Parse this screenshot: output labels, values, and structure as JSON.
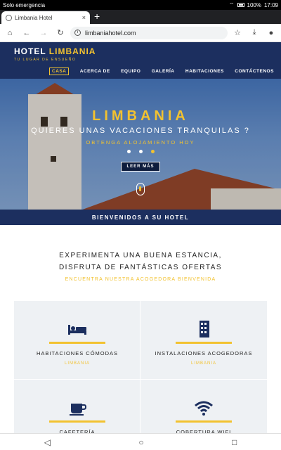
{
  "status_bar": {
    "left_text": "Solo emergencia",
    "battery": "100%",
    "time": "17:09"
  },
  "browser": {
    "tab_title": "Limbania Hotel",
    "tab_close": "×",
    "new_tab": "+",
    "url": "limbaniahotel.com",
    "icons": [
      "home-icon",
      "back-icon",
      "forward-icon",
      "reload-icon",
      "info-icon",
      "star-icon",
      "download-icon",
      "alert-icon"
    ]
  },
  "site": {
    "brand_prefix": "HOTEL ",
    "brand_highlight": "LIMBANIA",
    "tagline": "TU LUGAR DE ENSUEÑO",
    "nav": [
      "CASA",
      "ACERCA DE",
      "EQUIPO",
      "GALERÍA",
      "HABITACIONES",
      "CONTÁCTENOS"
    ]
  },
  "hero": {
    "title": "LIMBANIA",
    "subtitle": "QUIERES UNAS VACACIONES TRANQUILAS ?",
    "small": "OBTENGA ALOJAMIENTO HOY",
    "button": "LEER MÁS",
    "active_slide": 3,
    "slide_count": 3
  },
  "welcome": "BIENVENIDOS A SU HOTEL",
  "intro": {
    "line1": "EXPERIMENTA UNA BUENA ESTANCIA,",
    "line2": "DISFRUTA DE FANTÁSTICAS OFERTAS",
    "line3": "ENCUENTRA NUESTRA ACOGEDORA BIENVENIDA"
  },
  "features": [
    {
      "icon": "bed-icon",
      "title": "HABITACIONES CÓMODAS",
      "sub": "LIMBANIA"
    },
    {
      "icon": "building-icon",
      "title": "INSTALACIONES ACOGEDORAS",
      "sub": "LIMBANIA"
    },
    {
      "icon": "coffee-icon",
      "title": "CAFETERÍA",
      "sub": ""
    },
    {
      "icon": "wifi-icon",
      "title": "COBERTURA WIFI",
      "sub": ""
    }
  ],
  "colors": {
    "navy": "#1c2f5f",
    "gold": "#f2c230",
    "panel": "#eef1f4"
  }
}
